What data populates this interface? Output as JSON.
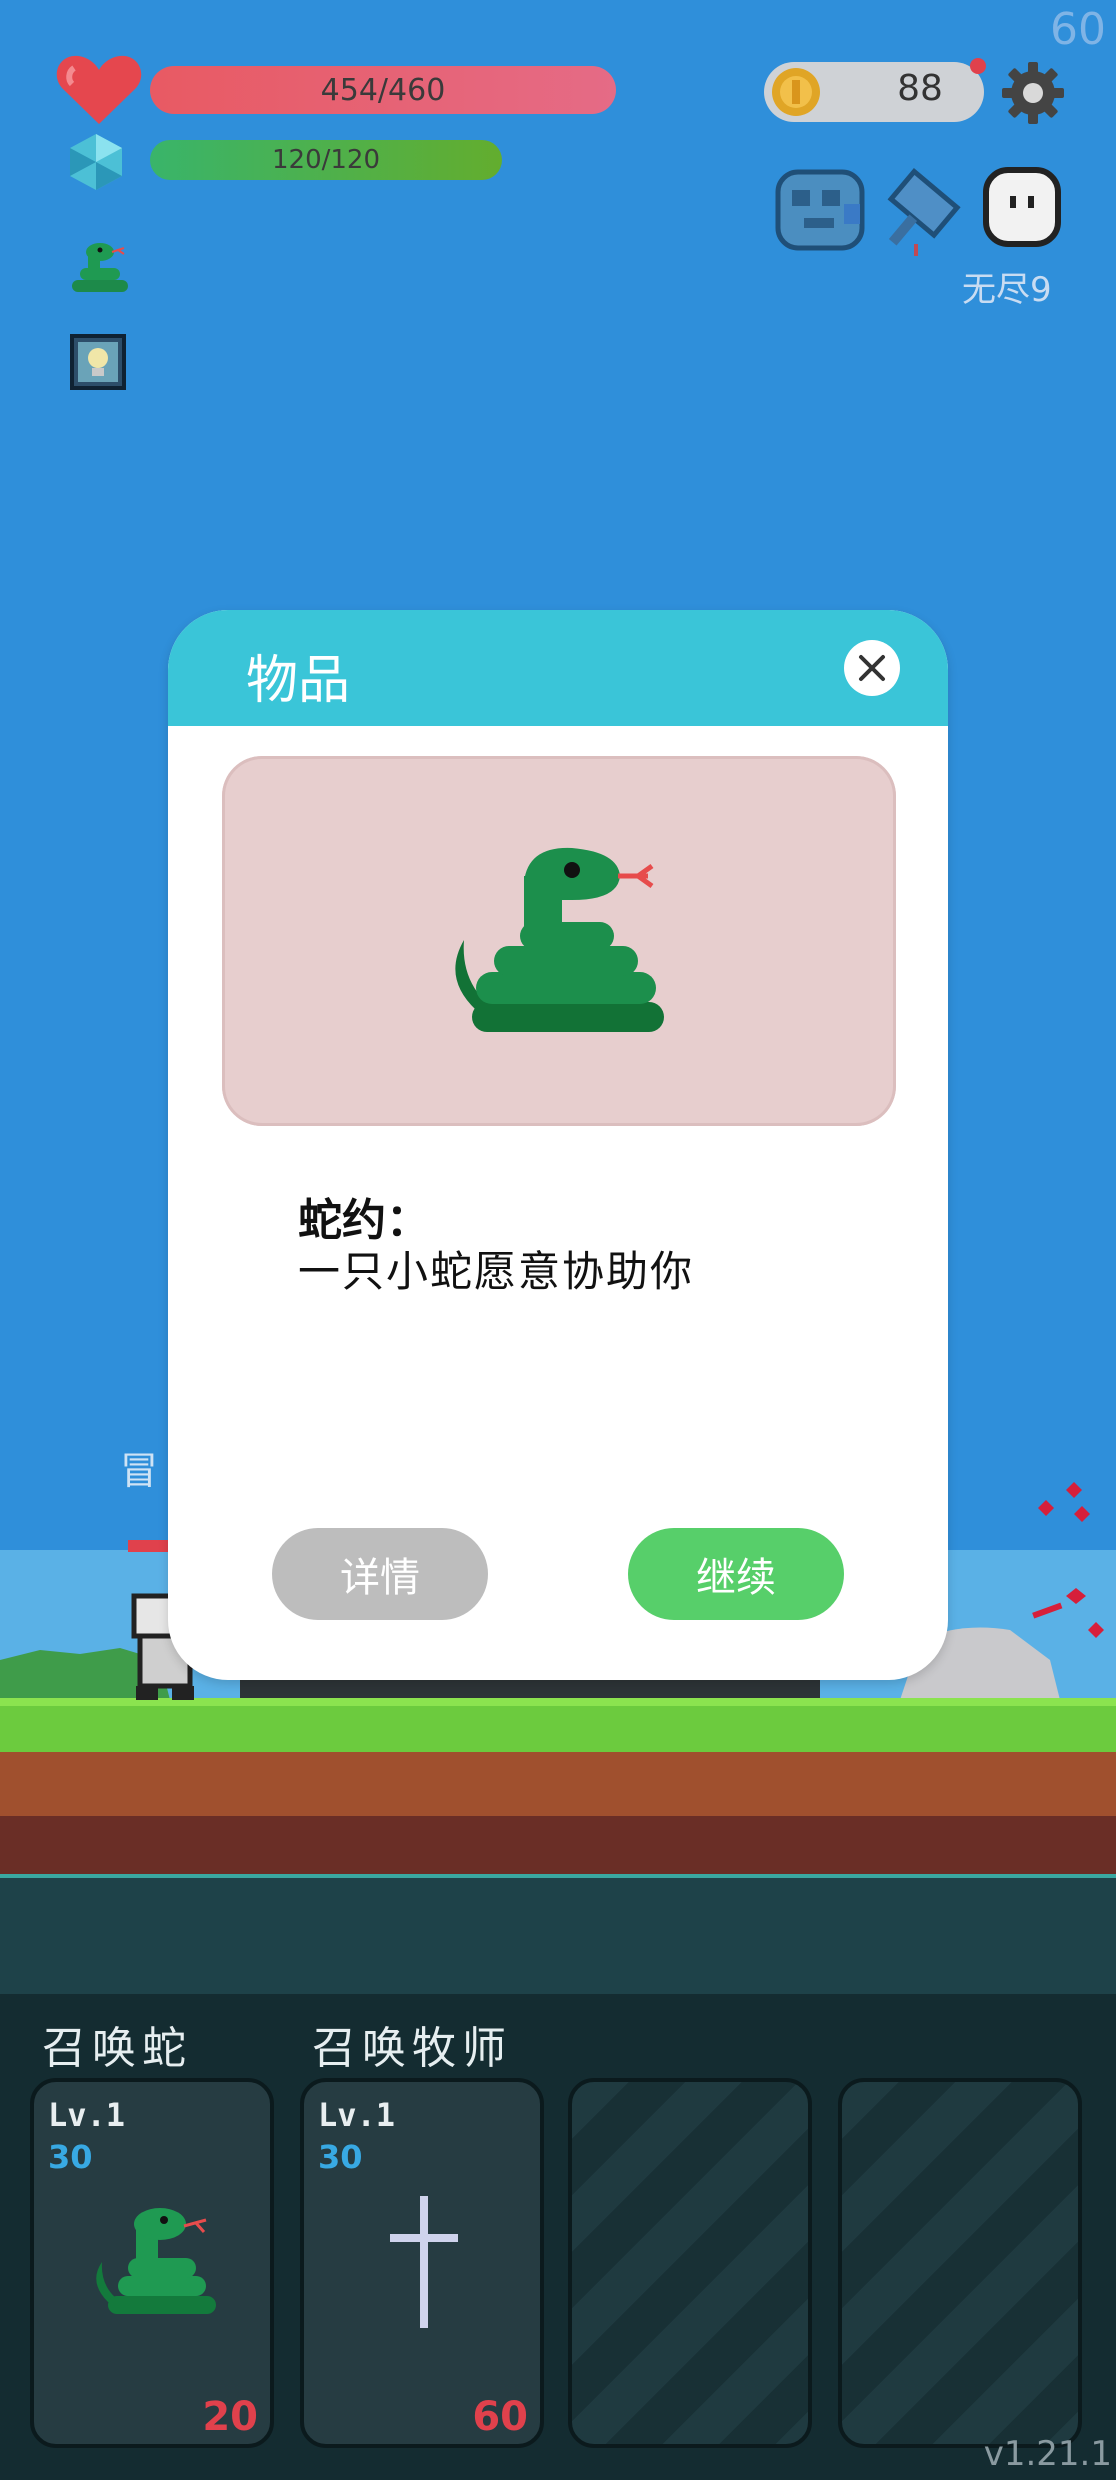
{
  "hud": {
    "fps": "60",
    "hp": "454/460",
    "mp": "120/120",
    "coins": "88",
    "mode": "无尽9"
  },
  "colors": {
    "modal_header": "#3ac5d8",
    "continue_button": "#57cf6a",
    "detail_button": "#bdbdbd",
    "hp_bar": "#e85a63",
    "mp_bar": "#39b46a",
    "card_price": "#e0414c",
    "card_cost": "#38a9e3"
  },
  "modal": {
    "title": "物品",
    "item_icon": "snake-icon",
    "item_name": "蛇约：",
    "item_desc": "一只小蛇愿意协助你",
    "detail_label": "详情",
    "continue_label": "继续"
  },
  "skills": [
    {
      "title": "召唤蛇",
      "level": "Lv.1",
      "cost": "30",
      "price": "20",
      "icon": "snake-icon"
    },
    {
      "title": "召唤牧师",
      "level": "Lv.1",
      "cost": "30",
      "price": "60",
      "icon": "cross-icon"
    }
  ],
  "version": "v1.21.1"
}
